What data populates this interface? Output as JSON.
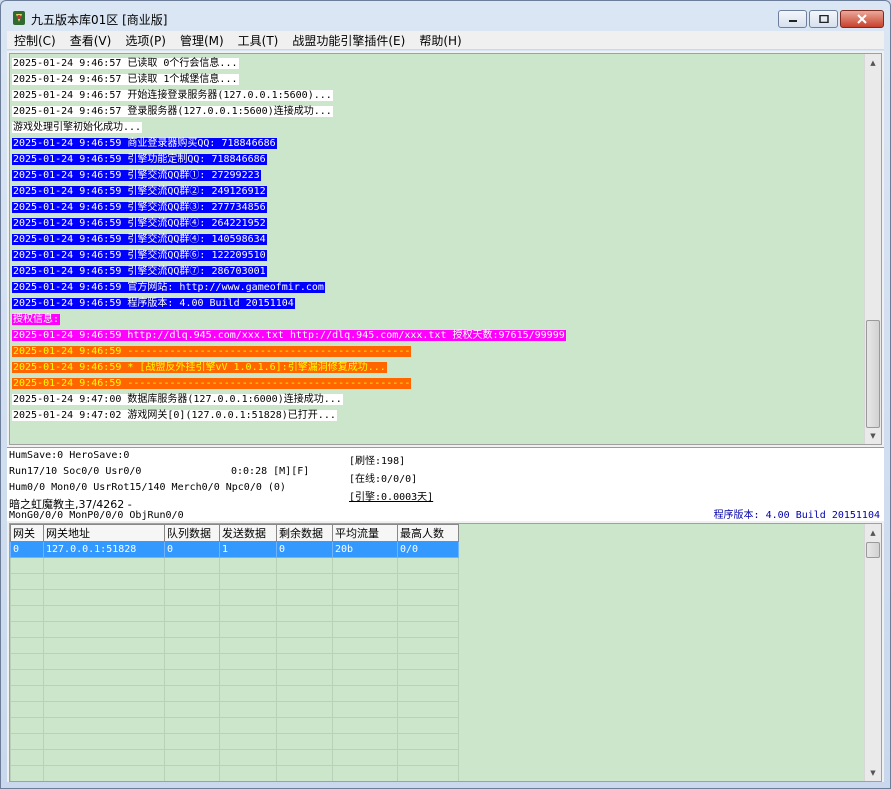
{
  "window": {
    "title": "九五版本库01区 [商业版]",
    "controls": {
      "minimize": "minimize",
      "maximize": "maximize",
      "close": "close"
    }
  },
  "menu": [
    "控制(C)",
    "查看(V)",
    "选项(P)",
    "管理(M)",
    "工具(T)",
    "战盟功能引擎插件(E)",
    "帮助(H)"
  ],
  "log": [
    {
      "text": "2025-01-24 9:46:57 已读取 0个行会信息...",
      "color": "#000000",
      "bg": "#ffffff"
    },
    {
      "text": "2025-01-24 9:46:57 已读取 1个城堡信息...",
      "color": "#000000",
      "bg": "#ffffff"
    },
    {
      "text": "2025-01-24 9:46:57 开始连接登录服务器(127.0.0.1:5600)...",
      "color": "#000000",
      "bg": "#ffffff"
    },
    {
      "text": "2025-01-24 9:46:57 登录服务器(127.0.0.1:5600)连接成功...",
      "color": "#000000",
      "bg": "#ffffff"
    },
    {
      "text": "游戏处理引擎初始化成功...",
      "color": "#000000",
      "bg": "#ffffff"
    },
    {
      "text": "2025-01-24 9:46:59 商业登录器购买QQ: 718846686",
      "color": "#ffffff",
      "bg": "#0000ff"
    },
    {
      "text": "2025-01-24 9:46:59 引擎功能定制QQ: 718846686",
      "color": "#ffffff",
      "bg": "#0000ff"
    },
    {
      "text": "2025-01-24 9:46:59 引擎交流QQ群①: 27299223",
      "color": "#ffffff",
      "bg": "#0000ff"
    },
    {
      "text": "2025-01-24 9:46:59 引擎交流QQ群②: 249126912",
      "color": "#ffffff",
      "bg": "#0000ff"
    },
    {
      "text": "2025-01-24 9:46:59 引擎交流QQ群③: 277734856",
      "color": "#ffffff",
      "bg": "#0000ff"
    },
    {
      "text": "2025-01-24 9:46:59 引擎交流QQ群④: 264221952",
      "color": "#ffffff",
      "bg": "#0000ff"
    },
    {
      "text": "2025-01-24 9:46:59 引擎交流QQ群④: 140598634",
      "color": "#ffffff",
      "bg": "#0000ff"
    },
    {
      "text": "2025-01-24 9:46:59 引擎交流QQ群⑥: 122209510",
      "color": "#ffffff",
      "bg": "#0000ff"
    },
    {
      "text": "2025-01-24 9:46:59 引擎交流QQ群⑦: 286703001",
      "color": "#ffffff",
      "bg": "#0000ff"
    },
    {
      "text": "2025-01-24 9:46:59 官方网站: http://www.gameofmir.com",
      "color": "#ffffff",
      "bg": "#0000ff"
    },
    {
      "text": "2025-01-24 9:46:59 程序版本: 4.00 Build 20151104",
      "color": "#ffffff",
      "bg": "#0000ff"
    },
    {
      "text": "授权信息:",
      "color": "#ffffff",
      "bg": "#ff00ff"
    },
    {
      "text": "2025-01-24 9:46:59 http://dlq.945.com/xxx.txt http://dlq.945.com/xxx.txt 授权天数:97615/99999",
      "color": "#ffffff",
      "bg": "#ff00ff"
    },
    {
      "text": "2025-01-24 9:46:59 -----------------------------------------------",
      "color": "#ffff00",
      "bg": "#ff6600"
    },
    {
      "text": "2025-01-24 9:46:59 * [战盟反外挂引擎vV 1.0.1.6]:引擎漏洞修复成功...",
      "color": "#ffff00",
      "bg": "#ff6600"
    },
    {
      "text": "2025-01-24 9:46:59 -----------------------------------------------",
      "color": "#ffff00",
      "bg": "#ff6600"
    },
    {
      "text": "2025-01-24 9:47:00 数据库服务器(127.0.0.1:6000)连接成功...",
      "color": "#000000",
      "bg": "#ffffff"
    },
    {
      "text": "2025-01-24 9:47:02 游戏网关[0](127.0.0.1:51828)已打开...",
      "color": "#000000",
      "bg": "#ffffff"
    }
  ],
  "status": {
    "line1": "HumSave:0 HeroSave:0",
    "line2": "Run17/10 Soc0/0 Usr0/0",
    "timer": "0:0:28 [M][F]",
    "line3": "Hum0/0 Mon0/0 UsrRot15/140 Merch0/0 Npc0/0 (0)",
    "line4": "暗之虹魔教主,37/4262 -",
    "line5": "MonG0/0/0 MonP0/0/0 ObjRun0/0",
    "refresh": "[刷怪:198]",
    "online": "[在线:0/0/0]",
    "engine": "[引擎:0.0003天]",
    "version": "程序版本: 4.00 Build 20151104"
  },
  "gateway_table": {
    "headers": [
      "网关",
      "网关地址",
      "队列数据",
      "发送数据",
      "剩余数据",
      "平均流量",
      "最高人数"
    ],
    "rows": [
      [
        "0",
        "127.0.0.1:51828",
        "0",
        "1",
        "0",
        "20b",
        "0/0"
      ]
    ],
    "empty_rows": 14
  }
}
